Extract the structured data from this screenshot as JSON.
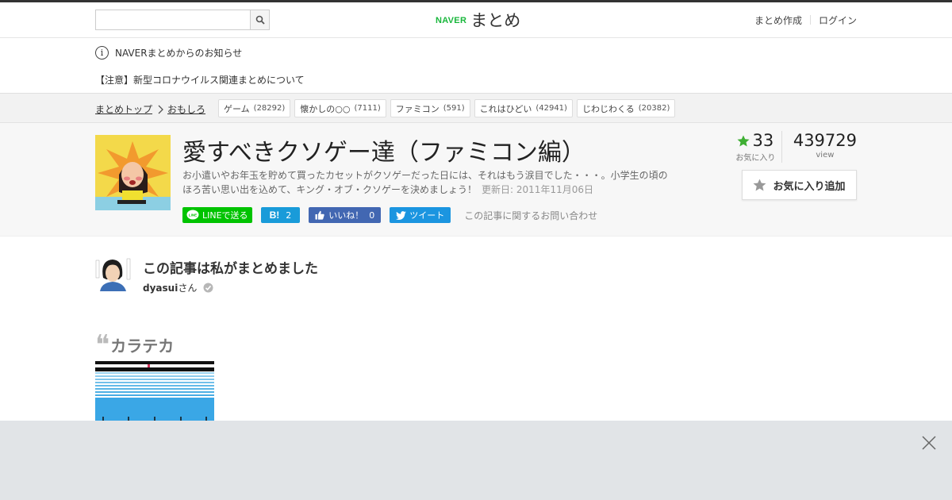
{
  "header": {
    "search_placeholder": "",
    "logo_brand": "NAVER",
    "logo_text": "まとめ",
    "links": [
      "まとめ作成",
      "ログイン"
    ]
  },
  "notice": {
    "info_text": "NAVERまとめからのお知らせ",
    "alert_text": "【注意】新型コロナウイルス関連まとめについて"
  },
  "breadcrumb": {
    "items": [
      "まとめトップ",
      "おもしろ"
    ]
  },
  "tags": [
    {
      "label": "ゲーム",
      "count": "(28292)"
    },
    {
      "label": "懐かしの○○",
      "count": "(7111)"
    },
    {
      "label": "ファミコン",
      "count": "(591)"
    },
    {
      "label": "これはひどい",
      "count": "(42941)"
    },
    {
      "label": "じわじわくる",
      "count": "(20382)"
    }
  ],
  "article": {
    "title": "愛すべきクソゲー達（ファミコン編）",
    "description": "お小遣いやお年玉を貯めて買ったカセットがクソゲーだった日には、それはもう涙目でした・・・。小学生の頃のほろ苦い思い出を込めて、キング・オブ・クソゲーを決めましょう！",
    "updated": "更新日: 2011年11月06日",
    "share": {
      "line": "LINEで送る",
      "hatena_count": "2",
      "fb_label": "いいね！",
      "fb_count": "0",
      "tweet": "ツイート"
    },
    "inquiry": "この記事に関するお問い合わせ",
    "favorites": "33",
    "favorites_label": "お気に入り",
    "views": "439729",
    "views_label": "view",
    "fav_button": "お気に入り追加"
  },
  "author": {
    "heading": "この記事は私がまとめました",
    "name": "dyasui",
    "suffix": "さん"
  },
  "section": {
    "title": "カラテカ"
  },
  "colors": {
    "naver_green": "#19b73c",
    "star_green": "#3eaf33",
    "line_green": "#00c300",
    "hatena_blue": "#199bd9",
    "facebook_blue": "#4267b2",
    "twitter_blue": "#1b95e0",
    "ad_bar": "#e1e4e7"
  }
}
